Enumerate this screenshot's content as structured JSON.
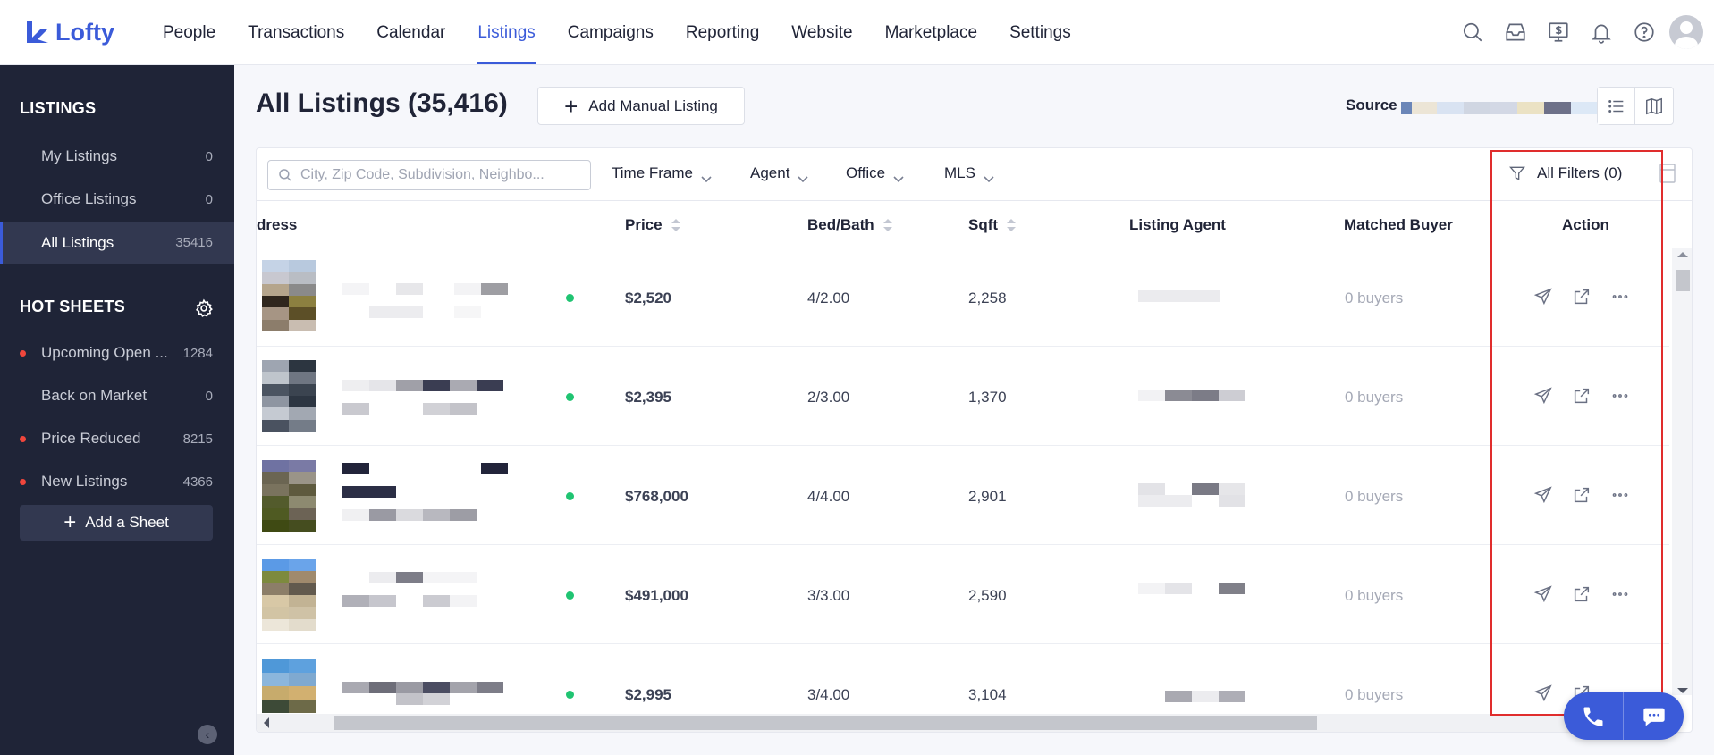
{
  "app": {
    "logo_text": "Lofty",
    "brand_color": "#3b5bd9"
  },
  "nav": {
    "items": [
      {
        "label": "People"
      },
      {
        "label": "Transactions"
      },
      {
        "label": "Calendar"
      },
      {
        "label": "Listings",
        "active": true
      },
      {
        "label": "Campaigns"
      },
      {
        "label": "Reporting"
      },
      {
        "label": "Website"
      },
      {
        "label": "Marketplace"
      },
      {
        "label": "Settings"
      }
    ],
    "icons": [
      "search-icon",
      "inbox-icon",
      "dollar-screen-icon",
      "bell-icon",
      "help-icon",
      "avatar"
    ]
  },
  "sidebar": {
    "listings_title": "LISTINGS",
    "listings": [
      {
        "label": "My Listings",
        "count": "0"
      },
      {
        "label": "Office Listings",
        "count": "0"
      },
      {
        "label": "All Listings",
        "count": "35416",
        "active": true
      }
    ],
    "hotsheets_title": "HOT SHEETS",
    "hotsheets": [
      {
        "label": "Upcoming Open ...",
        "count": "1284",
        "dot": true
      },
      {
        "label": "Back on Market",
        "count": "0",
        "dot": false
      },
      {
        "label": "Price Reduced",
        "count": "8215",
        "dot": true
      },
      {
        "label": "New Listings",
        "count": "4366",
        "dot": true
      }
    ],
    "add_sheet": "Add a Sheet"
  },
  "main": {
    "title": "All Listings (35,416)",
    "add_manual": "Add Manual Listing",
    "source_label": "Source"
  },
  "filters": {
    "search_placeholder": "City, Zip Code, Subdivision, Neighbo...",
    "time_frame": "Time Frame",
    "agent": "Agent",
    "office": "Office",
    "mls": "MLS",
    "all_filters": "All Filters (0)"
  },
  "table": {
    "headers": {
      "address": "dress",
      "price": "Price",
      "bedbath": "Bed/Bath",
      "sqft": "Sqft",
      "listing_agent": "Listing Agent",
      "matched_buyer": "Matched Buyer",
      "action": "Action"
    },
    "rows": [
      {
        "price": "$2,520",
        "bedbath": "4/2.00",
        "sqft": "2,258",
        "buyers": "0 buyers"
      },
      {
        "price": "$2,395",
        "bedbath": "2/3.00",
        "sqft": "1,370",
        "buyers": "0 buyers"
      },
      {
        "price": "$768,000",
        "bedbath": "4/4.00",
        "sqft": "2,901",
        "buyers": "0 buyers"
      },
      {
        "price": "$491,000",
        "bedbath": "3/3.00",
        "sqft": "2,590",
        "buyers": "0 buyers"
      },
      {
        "price": "$2,995",
        "bedbath": "3/4.00",
        "sqft": "3,104",
        "buyers": "0 buyers"
      }
    ]
  }
}
